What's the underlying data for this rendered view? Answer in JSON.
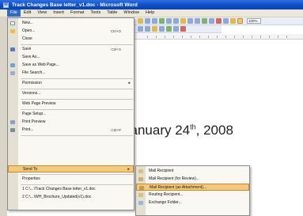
{
  "window": {
    "title": "Track Changes Base letter_v1.doc - Microsoft Word",
    "icon": "word-app-icon"
  },
  "menubar": {
    "items": [
      {
        "label": "File",
        "active": true
      },
      {
        "label": "Edit"
      },
      {
        "label": "View"
      },
      {
        "label": "Insert"
      },
      {
        "label": "Format"
      },
      {
        "label": "Tools"
      },
      {
        "label": "Table"
      },
      {
        "label": "Window"
      },
      {
        "label": "Help"
      }
    ]
  },
  "toolbar": {
    "zoom": "100%"
  },
  "document": {
    "date_main": "January 24",
    "date_sup": "th",
    "date_year": ", 2008"
  },
  "file_menu": {
    "items": [
      {
        "label": "New...",
        "icon": "new-document-icon"
      },
      {
        "label": "Open...",
        "shortcut": "Ctrl+O",
        "icon": "open-folder-icon"
      },
      {
        "label": "Close",
        "icon": ""
      },
      {
        "label": "Save",
        "shortcut": "Ctrl+S",
        "icon": "save-icon"
      },
      {
        "label": "Save As...",
        "icon": ""
      },
      {
        "label": "Save as Web Page...",
        "icon": "web-page-icon"
      },
      {
        "label": "File Search...",
        "icon": "file-search-icon"
      },
      {
        "label": "Permission",
        "icon": "",
        "arrow": true
      },
      {
        "label": "Versions...",
        "icon": ""
      },
      {
        "label": "Web Page Preview",
        "icon": ""
      },
      {
        "label": "Page Setup...",
        "icon": ""
      },
      {
        "label": "Print Preview",
        "icon": "print-preview-icon"
      },
      {
        "label": "Print...",
        "shortcut": "Ctrl+P",
        "icon": "print-icon"
      },
      {
        "label": "Send To",
        "icon": "",
        "arrow": true
      },
      {
        "label": "Properties",
        "icon": ""
      },
      {
        "label": "1 C:\\...\\Track Changes Base letter_v1.doc",
        "icon": ""
      },
      {
        "label": "2 C:\\...\\WH_Brochure_Updated(v1).doc",
        "icon": ""
      }
    ]
  },
  "send_to_menu": {
    "items": [
      {
        "label": "Mail Recipient",
        "icon": "mail-icon"
      },
      {
        "label": "Mail Recipient (for Review)...",
        "icon": "mail-review-icon"
      },
      {
        "label": "Mail Recipient (as Attachment)...",
        "icon": "mail-attachment-icon"
      },
      {
        "label": "Routing Recipient...",
        "icon": "routing-icon"
      },
      {
        "label": "Exchange Folder...",
        "icon": "exchange-folder-icon"
      }
    ]
  }
}
